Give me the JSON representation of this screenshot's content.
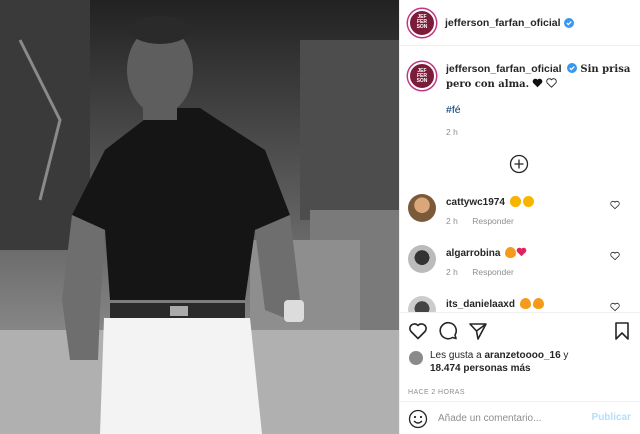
{
  "colors": {
    "accent": "#0095f6",
    "publish_disabled": "#b2dffc",
    "verified": "#3897f0",
    "text": "#262626",
    "muted": "#8e8e8e",
    "link": "#00376b"
  },
  "header": {
    "username": "jefferson_farfan_oficial",
    "avatar_text": "JEF\nFER\nSON"
  },
  "caption": {
    "username": "jefferson_farfan_oficial",
    "text": "Sin prisa pero con alma.",
    "hashtag": "#fé",
    "time": "2 h"
  },
  "comments": [
    {
      "username": "cattywc1974",
      "time": "2 h",
      "reply": "Responder"
    },
    {
      "username": "algarrobina",
      "time": "2 h",
      "reply": "Responder"
    },
    {
      "username": "its_danielaaxd",
      "time": "",
      "reply": ""
    }
  ],
  "likes": {
    "prefix": "Les gusta a",
    "user": "aranzetoooo_16",
    "connector": "y",
    "count": "18.474 personas más"
  },
  "posted": "HACE 2 HORAS",
  "comment_box": {
    "placeholder": "Añade un comentario...",
    "publish": "Publicar"
  },
  "icons": [
    "heart-icon",
    "comment-icon",
    "share-icon",
    "bookmark-icon",
    "smile-icon",
    "plus-circle-icon",
    "verified-icon"
  ]
}
